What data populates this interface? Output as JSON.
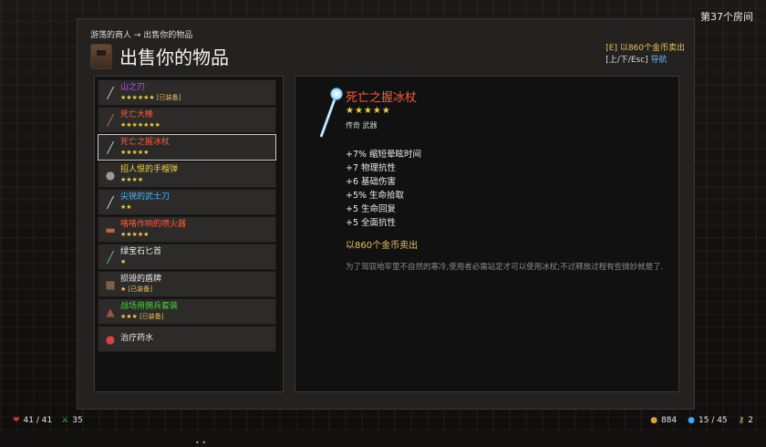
{
  "room": "第37个房间",
  "breadcrumb": "游荡的商人 → 出售你的物品",
  "title": "出售你的物品",
  "hint": {
    "sell_prefix": "[E] 以860个金币卖出",
    "nav_keys": "[上/下/Esc]",
    "nav_label": "导航"
  },
  "items": [
    {
      "name": "山之刃",
      "stars": "★★★★★★",
      "equipped": "[已装备]",
      "color": "#b050f0",
      "icon": "sword-icon"
    },
    {
      "name": "死亡大棒",
      "stars": "★★★★★★★",
      "equipped": "",
      "color": "#ff5a3a",
      "icon": "club-icon"
    },
    {
      "name": "死亡之握冰杖",
      "stars": "★★★★★",
      "equipped": "",
      "color": "#ff5a3a",
      "icon": "ice-staff-icon"
    },
    {
      "name": "招人恨的手榴弹",
      "stars": "★★★★",
      "equipped": "",
      "color": "#f0d040",
      "icon": "grenade-icon"
    },
    {
      "name": "尖锐的武士刀",
      "stars": "★★",
      "equipped": "",
      "color": "#4ab8ff",
      "icon": "katana-icon"
    },
    {
      "name": "咯咯作响的喷火器",
      "stars": "★★★★★",
      "equipped": "",
      "color": "#ff5a3a",
      "icon": "flamethrower-icon"
    },
    {
      "name": "绿宝石匕首",
      "stars": "★",
      "equipped": "",
      "color": "#eaeaea",
      "icon": "dagger-icon"
    },
    {
      "name": "损毁的盾牌",
      "stars": "★",
      "equipped": "[已装备]",
      "color": "#eaeaea",
      "icon": "shield-icon"
    },
    {
      "name": "战场用佣兵套装",
      "stars": "★★★",
      "equipped": "[已装备]",
      "color": "#4ad040",
      "icon": "armor-icon"
    },
    {
      "name": "治疗药水",
      "stars": "",
      "equipped": "",
      "color": "#eaeaea",
      "icon": "potion-icon"
    }
  ],
  "pager": "• •",
  "detail": {
    "name": "死亡之握冰杖",
    "stars": "★★★★★",
    "type": "传奇 武器",
    "stats": [
      "+7% 缩短晕眩时间",
      "+7 物理抗性",
      "+6 基础伤害",
      "+5% 生命拾取",
      "+5 生命回复",
      "+5 全面抗性"
    ],
    "price": "以860个金币卖出",
    "description": "为了驾驭地牢里不自然的寒冷,使用者必需站定才可以使用冰杖;不过释放过程有些微妙就是了."
  },
  "hud": {
    "health": "41 / 41",
    "attack": "35",
    "gold": "884",
    "mana": "15 / 45",
    "keys": "2"
  },
  "colors": {
    "gold": "#e8c05a",
    "legendary": "#ff5a3a",
    "blue_link": "#6ab0ff"
  }
}
